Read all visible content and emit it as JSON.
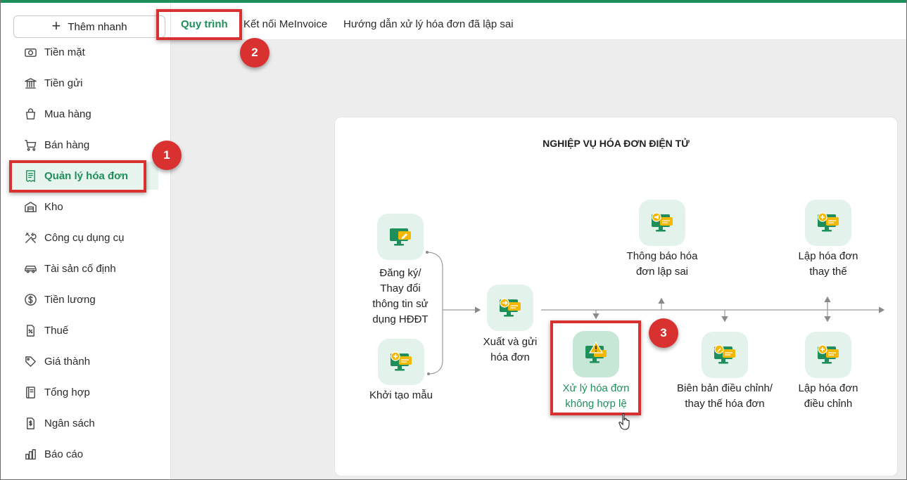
{
  "sidebar": {
    "quick_add_label": "Thêm nhanh",
    "items": [
      {
        "label": "Tiền mặt",
        "icon": "camera-icon"
      },
      {
        "label": "Tiền gửi",
        "icon": "bank-icon"
      },
      {
        "label": "Mua hàng",
        "icon": "shopping-bag-icon"
      },
      {
        "label": "Bán hàng",
        "icon": "cart-icon"
      },
      {
        "label": "Quản lý hóa đơn",
        "icon": "receipt-icon",
        "active": true
      },
      {
        "label": "Kho",
        "icon": "warehouse-icon"
      },
      {
        "label": "Công cụ dụng cụ",
        "icon": "tools-icon"
      },
      {
        "label": "Tài sản cố định",
        "icon": "car-icon"
      },
      {
        "label": "Tiền lương",
        "icon": "dollar-circle-icon"
      },
      {
        "label": "Thuế",
        "icon": "tax-document-icon"
      },
      {
        "label": "Giá thành",
        "icon": "price-tag-icon"
      },
      {
        "label": "Tổng hợp",
        "icon": "ledger-icon"
      },
      {
        "label": "Ngân sách",
        "icon": "budget-document-icon"
      },
      {
        "label": "Báo cáo",
        "icon": "bar-chart-icon"
      }
    ]
  },
  "tabs": [
    {
      "label": "Quy trình",
      "active": true
    },
    {
      "label": "Kết nối MeInvoice"
    },
    {
      "label": "Hướng dẫn xử lý hóa đơn đã lập sai"
    }
  ],
  "callouts": [
    "1",
    "2",
    "3"
  ],
  "process": {
    "title": "NGHIỆP VỤ HÓA ĐƠN ĐIỆN TỬ",
    "nodes": {
      "register": {
        "l1": "Đăng ký/",
        "l2": "Thay đổi",
        "l3": "thông tin sử",
        "l4": "dụng HĐĐT"
      },
      "template": {
        "l1": "Khởi tạo mẫu"
      },
      "issue": {
        "l1": "Xuất và gửi",
        "l2": "hóa đơn"
      },
      "notify": {
        "l1": "Thông báo hóa",
        "l2": "đơn lập sai"
      },
      "replace": {
        "l1": "Lập hóa đơn",
        "l2": "thay thế"
      },
      "invalid": {
        "l1": "Xử lý hóa đơn",
        "l2": "không hợp lệ"
      },
      "minutes": {
        "l1": "Biên bản điều chỉnh/",
        "l2": "thay thế hóa đơn"
      },
      "adjust": {
        "l1": "Lập hóa đơn",
        "l2": "điều chỉnh"
      }
    }
  },
  "colors": {
    "brand_green": "#1e8f5a",
    "callout_red": "#d93030",
    "icon_yellow": "#f5b800"
  }
}
